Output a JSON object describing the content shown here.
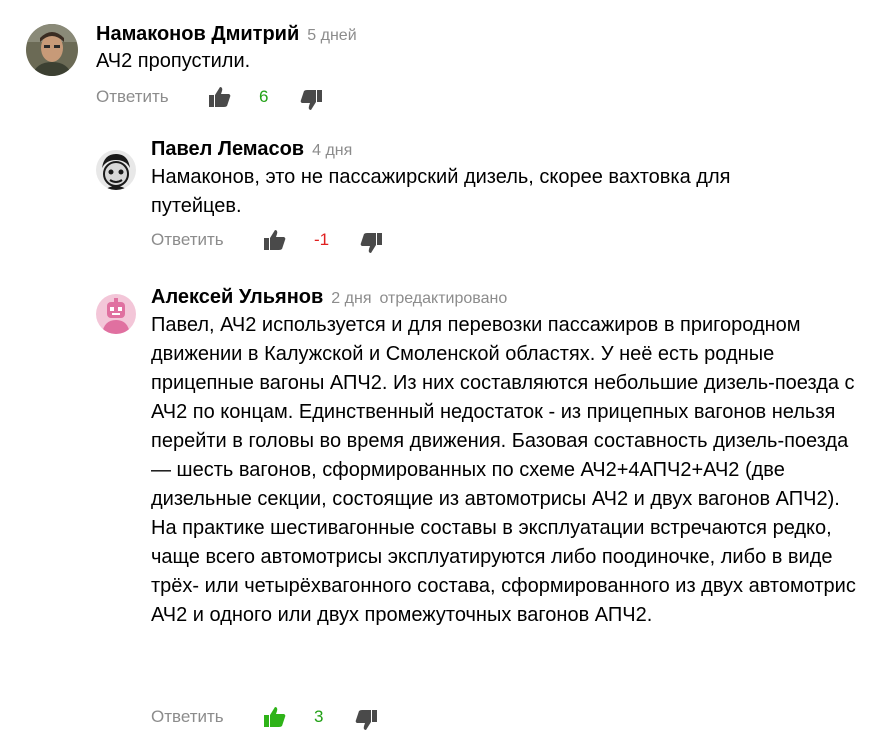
{
  "colors": {
    "positive": "#22a116",
    "negative": "#e02020",
    "icon_default": "#4a4a4a",
    "icon_active": "#2eb318",
    "meta": "#8c8c8c"
  },
  "comments": [
    {
      "author": "Намаконов Дмитрий",
      "time": "5 дней",
      "edited": "",
      "text": "АЧ2 пропустили.",
      "reply_label": "Ответить",
      "score": "6",
      "score_color": "positive",
      "liked": false,
      "avatar": "photo-avatar"
    },
    {
      "author": "Павел Лемасов",
      "time": "4 дня",
      "edited": "",
      "text": "Намаконов, это не пассажирский дизель, скорее вахтовка для путейцев.",
      "reply_label": "Ответить",
      "score": "-1",
      "score_color": "negative",
      "liked": false,
      "avatar": "cartoon-avatar"
    },
    {
      "author": "Алексей Ульянов",
      "time": "2 дня",
      "edited": "отредактировано",
      "text": "Павел, АЧ2 используется и для перевозки пассажиров в пригородном движении в Калужской и Смоленской областях. У неё есть родные прицепные вагоны АПЧ2. Из них составляются небольшие дизель-поезда с АЧ2 по концам. Единственный недостаток - из прицепных вагонов нельзя перейти в головы во время движения. Базовая составность дизель-поезда — шесть вагонов, сформированных по схеме АЧ2+4АПЧ2+АЧ2 (две дизельные секции, состоящие из автомотрисы АЧ2 и двух вагонов АПЧ2). На практике шестивагонные составы в эксплуатации встречаются редко, чаще всего автомотрисы эксплуатируются либо поодиночке, либо в виде трёх- или четырёхвагонного состава, сформированного из двух автомотрис АЧ2 и одного или двух промежуточных вагонов АПЧ2.",
      "reply_label": "Ответить",
      "score": "3",
      "score_color": "positive",
      "liked": true,
      "avatar": "pink-robot-avatar"
    }
  ]
}
